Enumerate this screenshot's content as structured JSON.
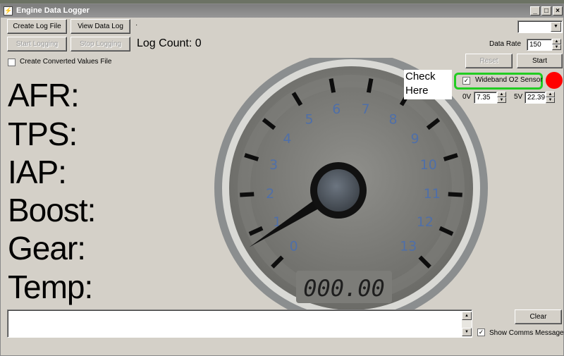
{
  "window": {
    "title": "Engine Data Logger",
    "controls": {
      "minimize": "_",
      "maximize": "□",
      "close": "×"
    }
  },
  "toolbar": {
    "create_log_file": "Create Log File",
    "view_data_log": "View Data Log",
    "separator_dot": "·",
    "start_logging": "Start Logging",
    "stop_logging": "Stop Logging",
    "log_count": "Log Count: 0",
    "create_converted_label": "Create Converted Values File",
    "create_converted_checked": false
  },
  "right_panel": {
    "dropdown_value": "",
    "data_rate_label": "Data Rate",
    "data_rate_value": "150",
    "reset": "Reset",
    "start": "Start",
    "wideband_label": "Wideband O2 Sensor",
    "wideband_checked": true,
    "wideband_check_glyph": "✓",
    "v0_label": "0V",
    "v0_value": "7.35",
    "v5_label": "5V",
    "v5_value": "22.39",
    "status_led_color": "#ff0000"
  },
  "annotation": {
    "check_here_line1": "Check",
    "check_here_line2": "Here",
    "highlight_color": "#22cc22"
  },
  "readouts": {
    "afr": "AFR:",
    "tps": "TPS:",
    "iap": "IAP:",
    "boost": "Boost:",
    "gear": "Gear:",
    "temp": "Temp:"
  },
  "gauge": {
    "min": 0,
    "max": 13,
    "value": 0.6,
    "tick_labels": [
      "0",
      "1",
      "2",
      "3",
      "4",
      "5",
      "6",
      "7",
      "8",
      "9",
      "10",
      "11",
      "12",
      "13"
    ],
    "digital_display": "000.00",
    "numeral_color": "#4f6fa8"
  },
  "messages": {
    "text": "",
    "show_comms_label": "Show Comms Messages",
    "show_comms_checked": true,
    "clear": "Clear"
  }
}
